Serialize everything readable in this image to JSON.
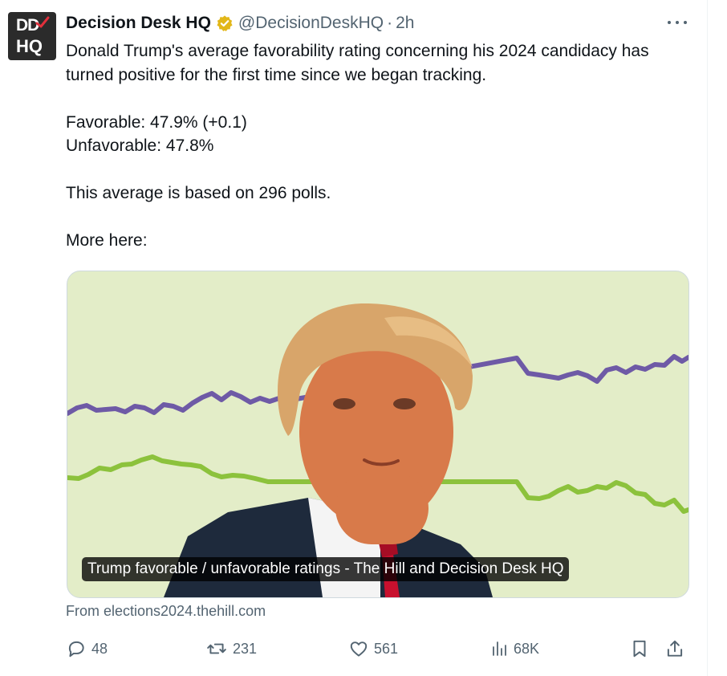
{
  "tweet": {
    "author_name": "Decision Desk HQ",
    "handle": "@DecisionDeskHQ",
    "separator": "·",
    "time": "2h",
    "avatar_text_top": "DD",
    "avatar_text_bottom": "HQ",
    "lines": [
      "Donald Trump's average favorability rating concerning his 2024 candidacy has turned positive for the first time since we began tracking.",
      "Favorable: 47.9% (+0.1)",
      "Unfavorable: 47.8%",
      "This average is based on 296 polls.",
      "More here:"
    ]
  },
  "card": {
    "caption": "Trump favorable / unfavorable ratings - The Hill and Decision Desk HQ",
    "source": "From elections2024.thehill.com",
    "colors": {
      "background": "#e3edc8",
      "favorable_line": "#6e5aa6",
      "unfavorable_line": "#8cc23c"
    }
  },
  "actions": {
    "replies": "48",
    "reposts": "231",
    "likes": "561",
    "views": "68K"
  },
  "colors": {
    "text": "#0f1419",
    "muted": "#536471",
    "verified": "#e2b719"
  }
}
